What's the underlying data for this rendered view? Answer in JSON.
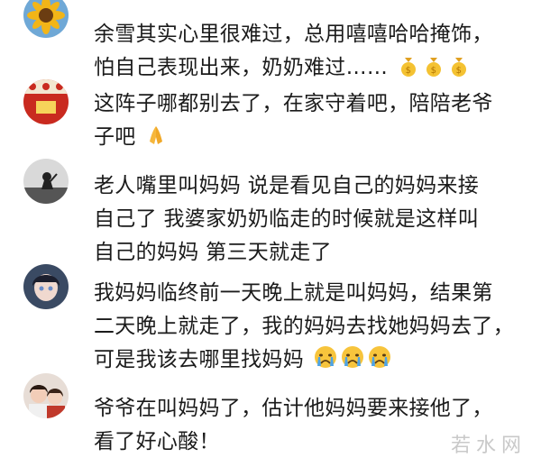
{
  "comments": [
    {
      "name": "",
      "lines": [
        "余雪其实心里很难过，总用嘻嘻哈哈掩饰，",
        "怕自己表现出来，奶奶难过……"
      ],
      "emoji": [
        "money-bag-icon",
        "money-bag-icon",
        "money-bag-icon"
      ],
      "avatar": "sunflower"
    },
    {
      "name": "",
      "lines": [
        "这阵子哪都别去了，在家守着吧，陪陪老爷",
        "子吧"
      ],
      "emoji": [
        "folded-hands-icon"
      ],
      "avatar": "red-banner"
    },
    {
      "name": "",
      "lines": [
        "老人嘴里叫妈妈 说是看见自己的妈妈来接",
        "自己了 我婆家奶奶临走的时候就是这样叫",
        "自己的妈妈 第三天就走了"
      ],
      "emoji": [],
      "avatar": "silhouette"
    },
    {
      "name": "",
      "lines": [
        "我妈妈临终前一天晚上就是叫妈妈，结果第",
        "二天晚上就走了，我的妈妈去找她妈妈去了，",
        "可是我该去哪里找妈妈"
      ],
      "emoji": [
        "crying-face-icon",
        "crying-face-icon",
        "crying-face-icon"
      ],
      "avatar": "anime-girl"
    },
    {
      "name": "",
      "lines": [
        "爷爷在叫妈妈了，估计他妈妈要来接他了，",
        "看了好心酸！"
      ],
      "emoji": [],
      "avatar": "two-people"
    }
  ],
  "watermark": "若水网",
  "colors": {
    "text": "#1b1b1b",
    "name": "#9a9a9a",
    "watermark": "#c9c9c9"
  }
}
